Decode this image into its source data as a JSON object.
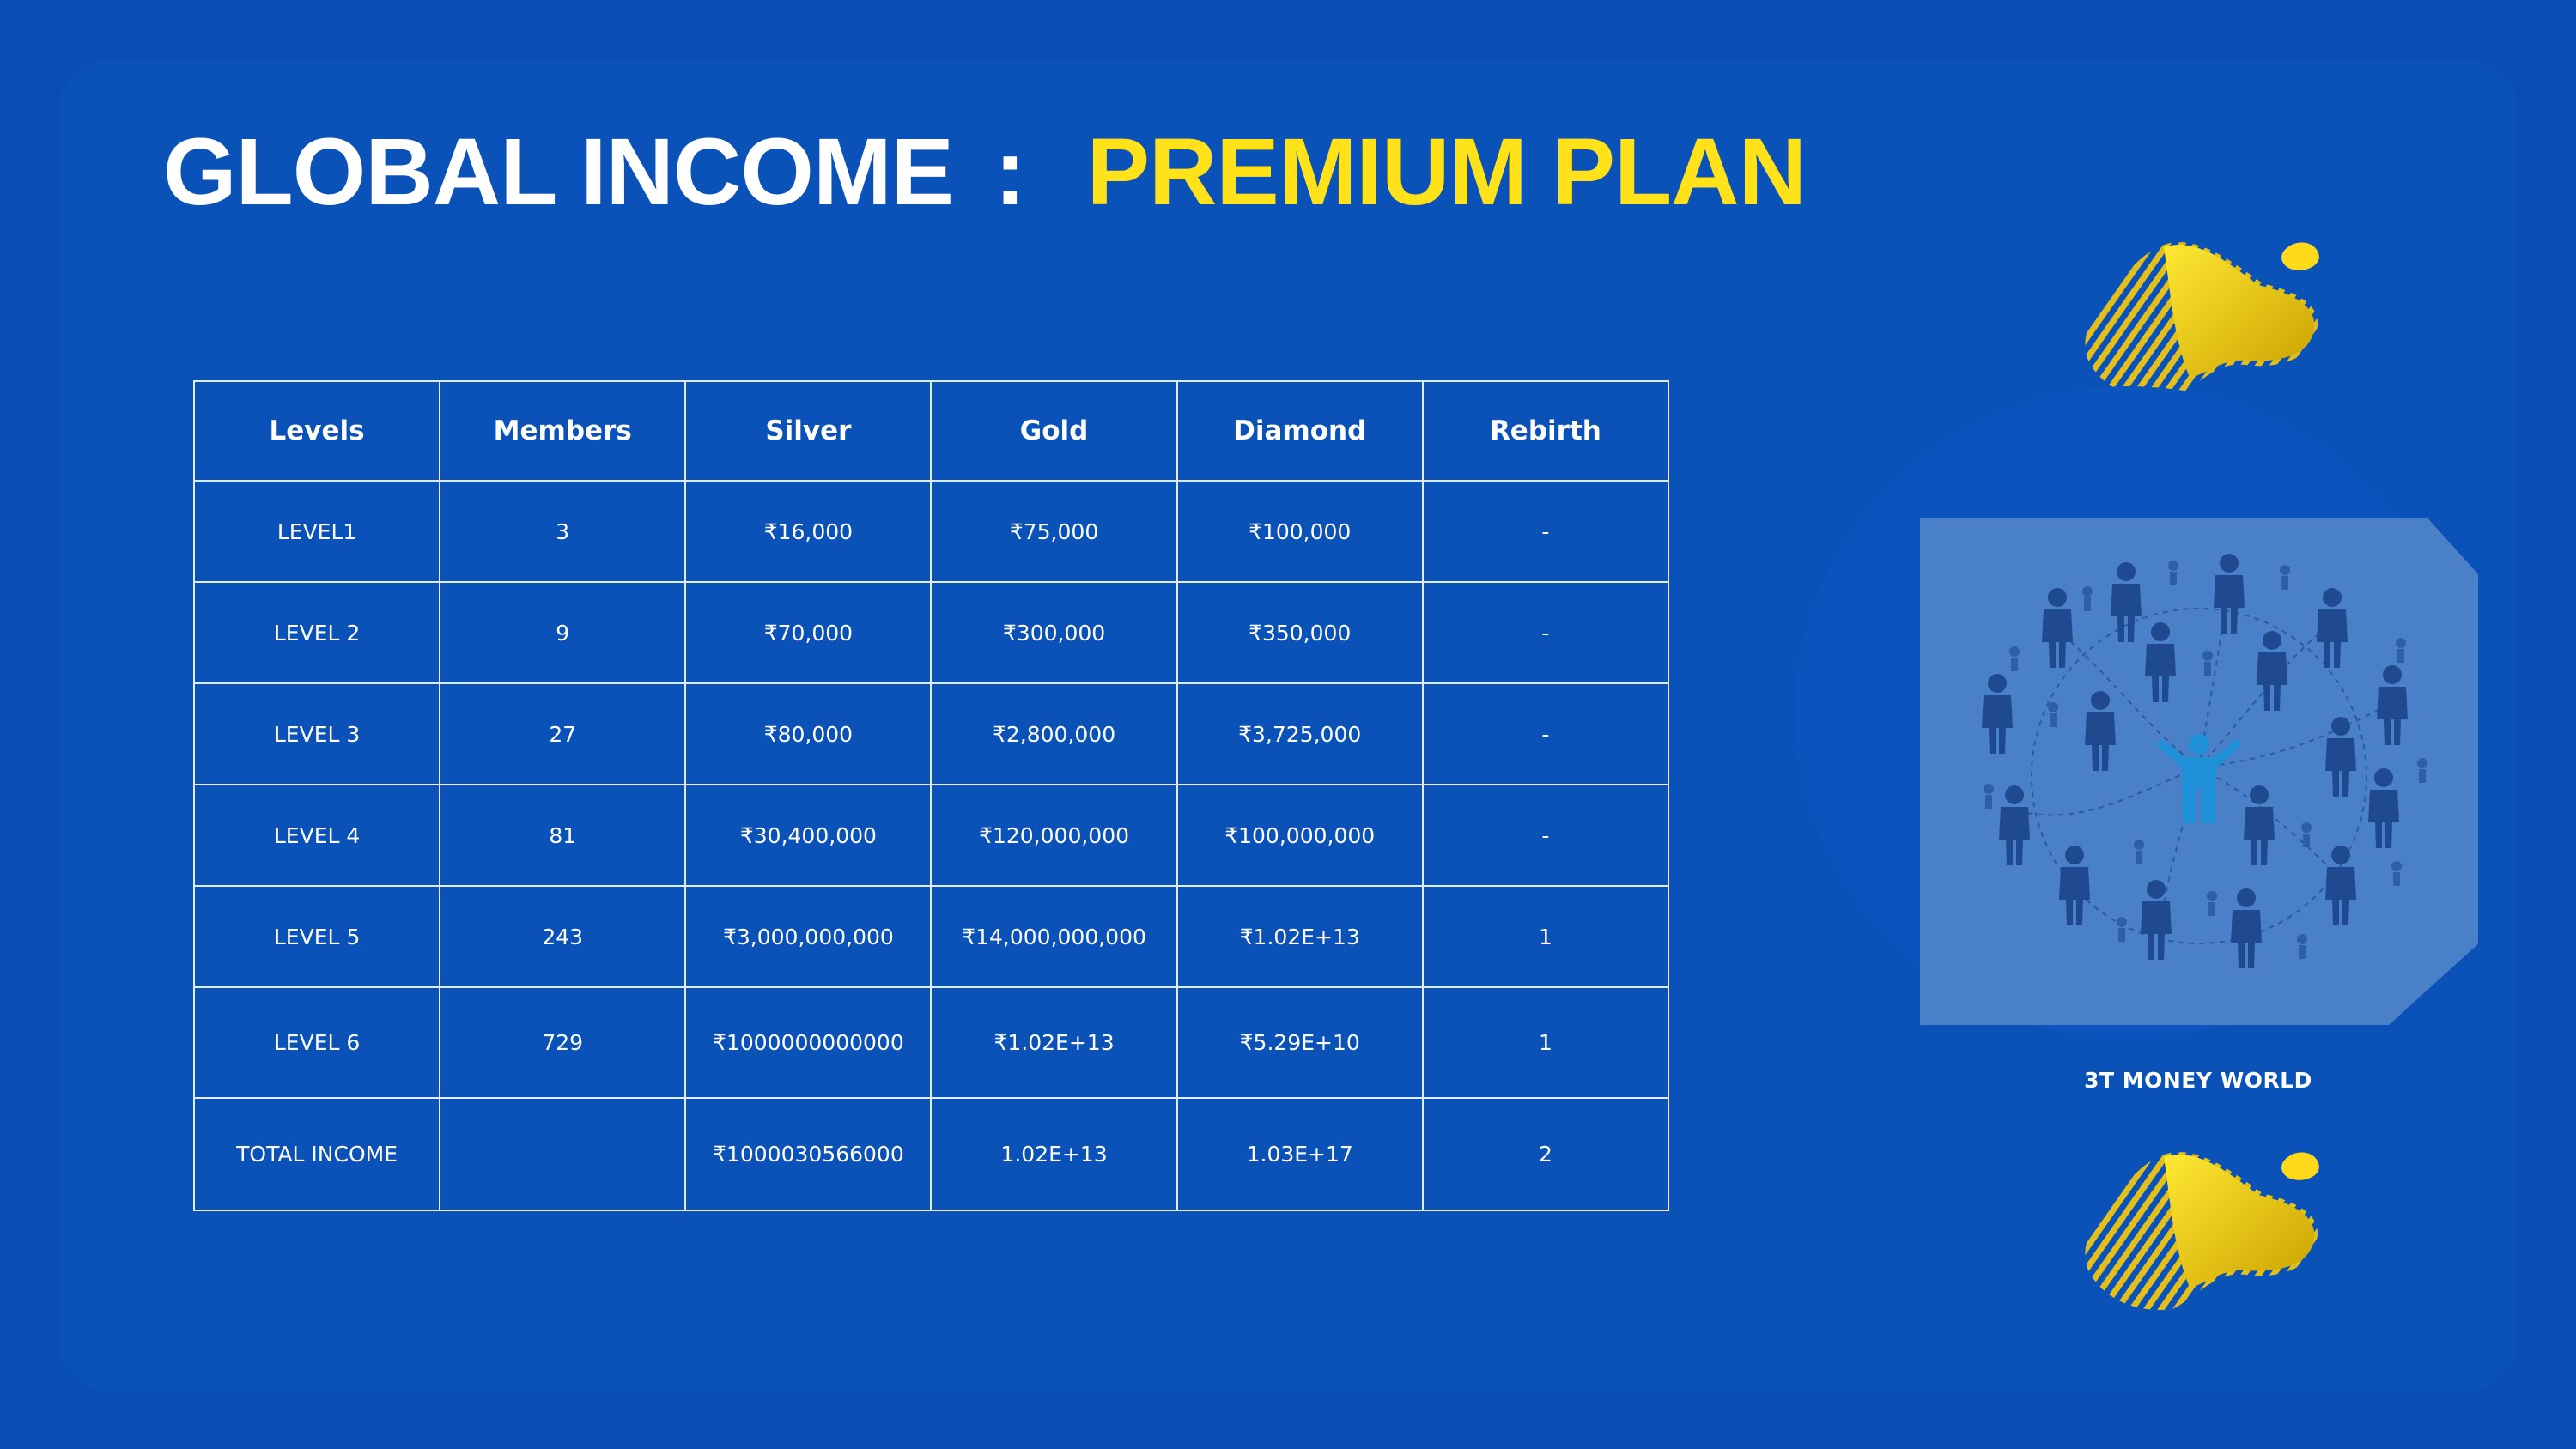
{
  "title": {
    "main": "GLOBAL INCOME",
    "separator": ":",
    "plan": "PREMIUM PLAN"
  },
  "table": {
    "headers": [
      "Levels",
      "Members",
      "Silver",
      "Gold",
      "Diamond",
      "Rebirth"
    ],
    "rows": [
      [
        "LEVEL1",
        "3",
        "₹16,000",
        "₹75,000",
        "₹100,000",
        "-"
      ],
      [
        "LEVEL 2",
        "9",
        "₹70,000",
        "₹300,000",
        "₹350,000",
        "-"
      ],
      [
        "LEVEL 3",
        "27",
        "₹80,000",
        "₹2,800,000",
        "₹3,725,000",
        "-"
      ],
      [
        "LEVEL 4",
        "81",
        "₹30,400,000",
        "₹120,000,000",
        "₹100,000,000",
        "-"
      ],
      [
        "LEVEL 5",
        "243",
        "₹3,000,000,000",
        "₹14,000,000,000",
        "₹1.02E+13",
        "1"
      ],
      [
        "LEVEL 6",
        "729",
        "₹1000000000000",
        "₹1.02E+13",
        "₹5.29E+10",
        "1"
      ],
      [
        "TOTAL INCOME",
        "",
        "₹1000030566000",
        "1.02E+13",
        "1.03E+17",
        "2"
      ]
    ]
  },
  "brand": "3T MONEY WORLD",
  "colors": {
    "background": "#0a4db3",
    "panel": "#0b52b8",
    "accent_yellow": "#ffe21a",
    "image_tile": "#4a80c8",
    "people_dark": "#1f4a8f",
    "people_center": "#1e90d8"
  },
  "icons": {
    "decoration": "yellow-blob-icon",
    "network": "people-network-icon"
  }
}
